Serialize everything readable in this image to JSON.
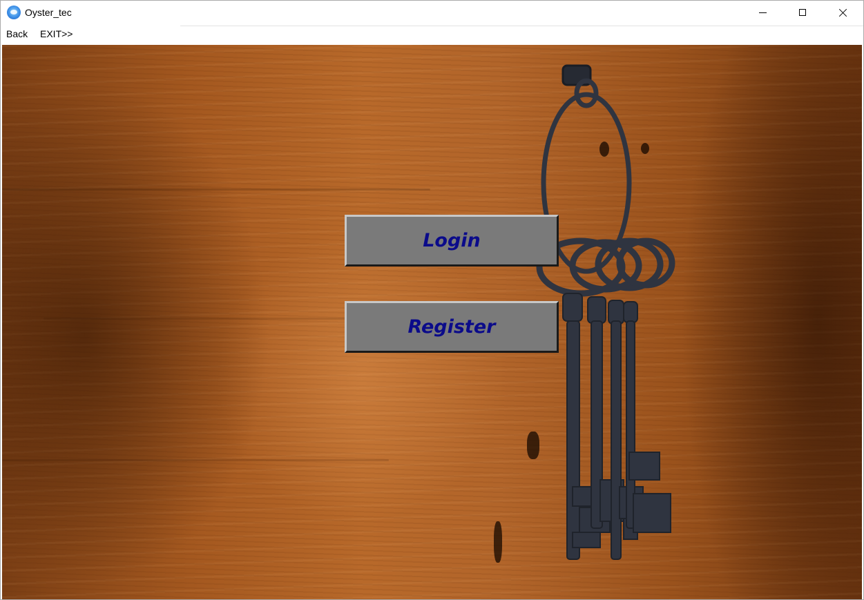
{
  "window": {
    "title": "Oyster_tec",
    "icon": "app-icon"
  },
  "menu": {
    "back_label": "Back",
    "exit_label": "EXIT>>"
  },
  "buttons": {
    "login_label": "Login",
    "register_label": "Register",
    "text_color": "#0b0b8a",
    "face_color": "#7a7a7a"
  },
  "background": {
    "description_icon": "keys-on-wood-image"
  }
}
